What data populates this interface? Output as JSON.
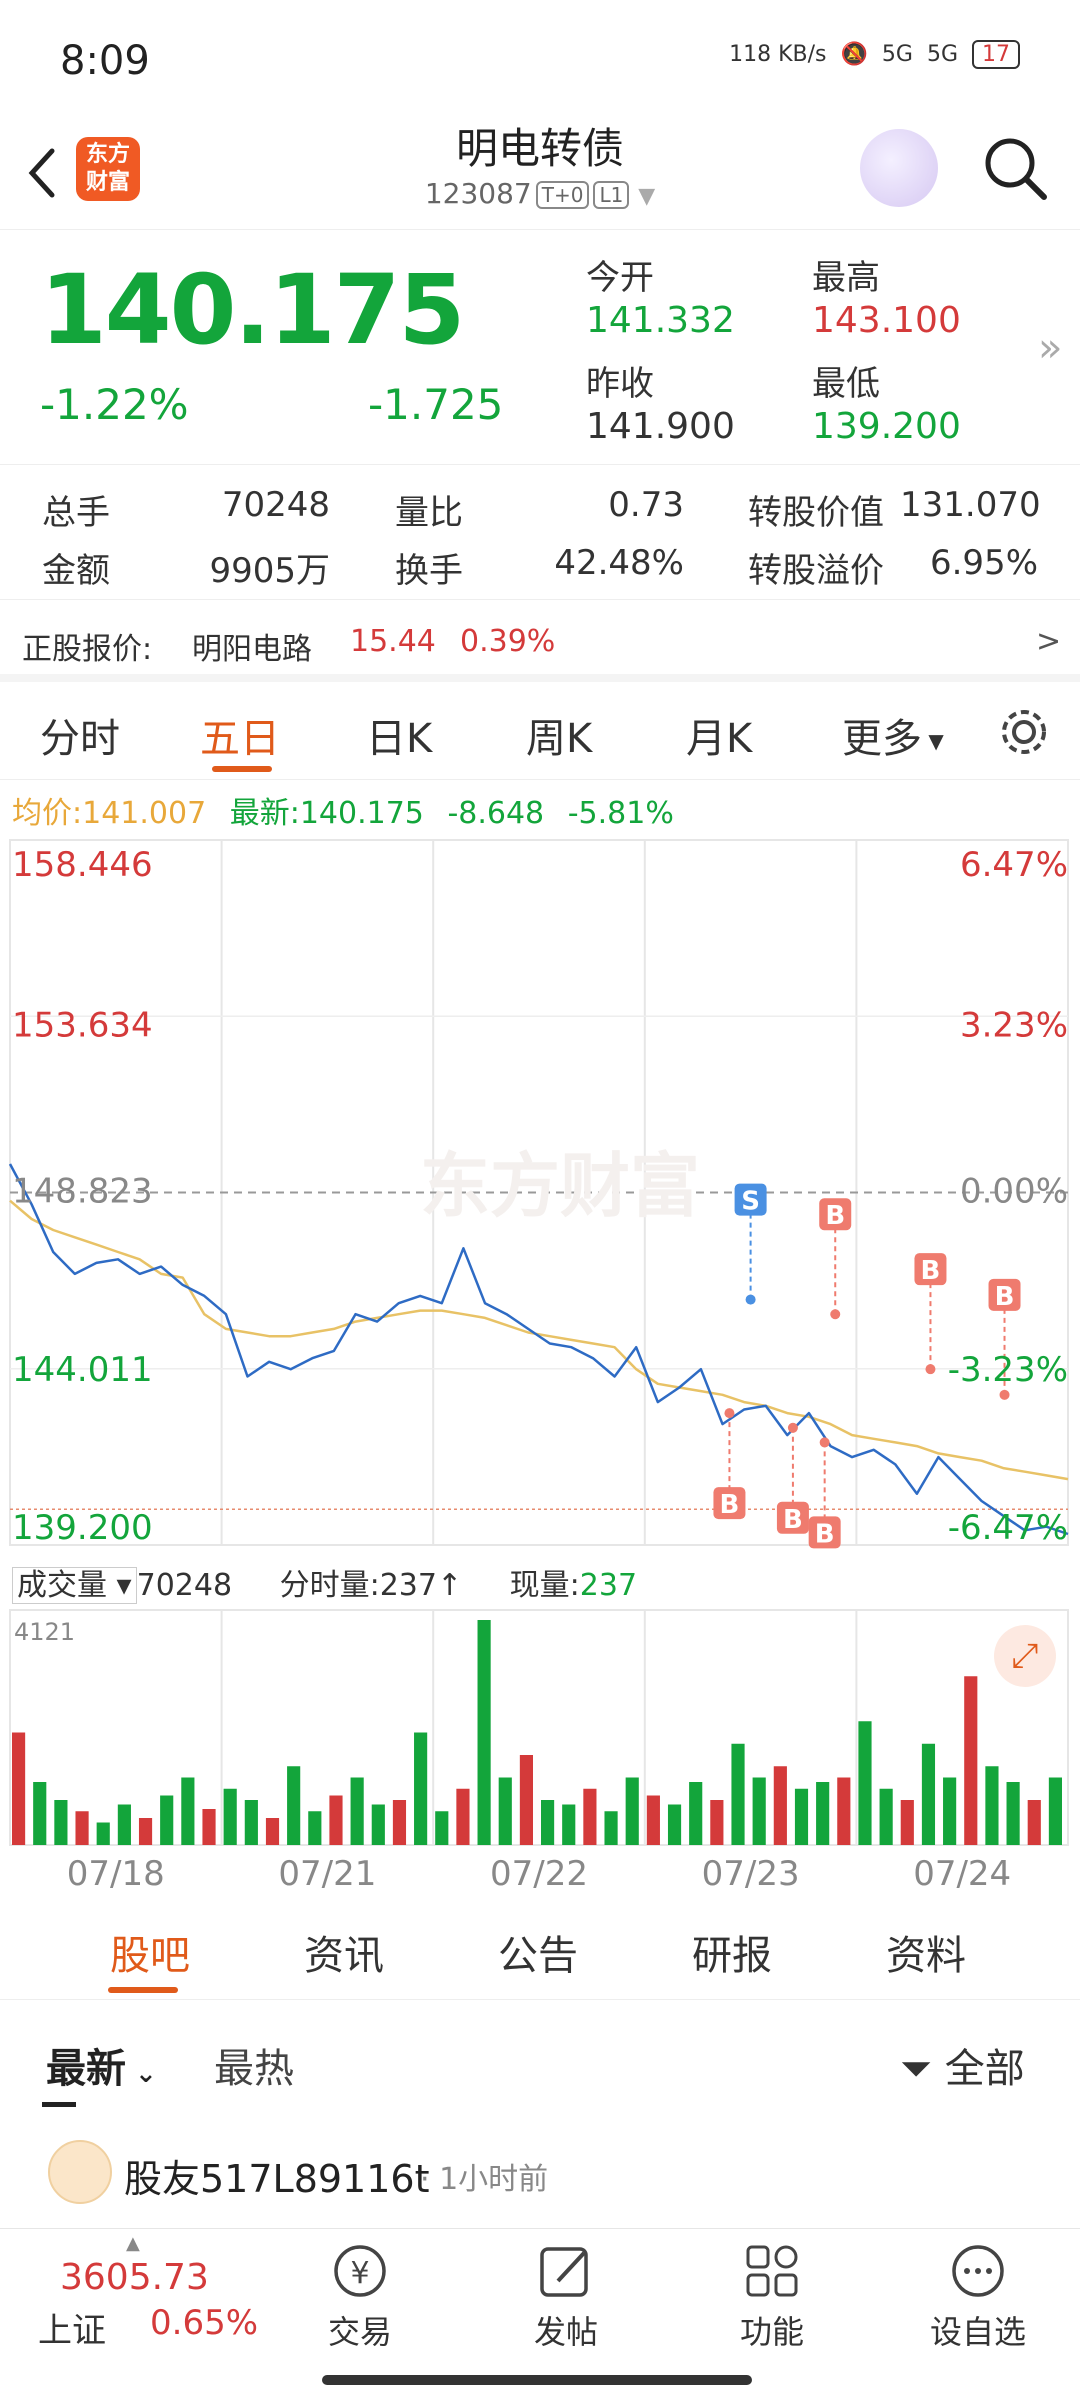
{
  "status": {
    "time": "8:09",
    "net_speed": "118 KB/s",
    "signal1": "5G",
    "signal2": "5G",
    "battery": "17"
  },
  "header": {
    "logo_text": "东方\n财富",
    "title": "明电转债",
    "code": "123087",
    "tag1": "T+0",
    "tag2": "L1"
  },
  "quote": {
    "price": "140.175",
    "pct": "-1.22%",
    "change": "-1.725",
    "open_label": "今开",
    "open": "141.332",
    "high_label": "最高",
    "high": "143.100",
    "prev_label": "昨收",
    "prev": "141.900",
    "low_label": "最低",
    "low": "139.200"
  },
  "stats": {
    "volume_label": "总手",
    "volume": "70248",
    "ratio_label": "量比",
    "ratio": "0.73",
    "conv_value_label": "转股价值",
    "conv_value": "131.070",
    "amount_label": "金额",
    "amount": "9905万",
    "turnover_label": "换手",
    "turnover": "42.48%",
    "premium_label": "转股溢价",
    "premium": "6.95%"
  },
  "stock": {
    "label": "正股报价:",
    "name": "明阳电路",
    "price": "15.44",
    "pct": "0.39%",
    "arrow": ">"
  },
  "tabs": [
    "分时",
    "五日",
    "日K",
    "周K",
    "月K",
    "更多"
  ],
  "chart_info": {
    "avg_label": "均价:",
    "avg": "141.007",
    "last_label": "最新:",
    "last": "140.175",
    "chg": "-8.648",
    "pct": "-5.81%"
  },
  "vol_info": {
    "vol_label": "成交量",
    "vol": "70248",
    "tick_label": "分时量:",
    "tick": "237",
    "now_label": "现量:",
    "now": "237"
  },
  "subtabs": [
    "股吧",
    "资讯",
    "公告",
    "研报",
    "资料"
  ],
  "feed": {
    "latest": "最新",
    "hot": "最热",
    "filter": "全部"
  },
  "post": {
    "user": "股友517L89116t",
    "time": "1小时前"
  },
  "bottom": {
    "index_value": "3605.73",
    "index_name": "上证",
    "index_pct": "0.65%",
    "nav": [
      "交易",
      "发帖",
      "功能",
      "设自选"
    ]
  },
  "chart_data": {
    "type": "line",
    "title": "",
    "x_labels": [
      "07/18",
      "07/21",
      "07/22",
      "07/23",
      "07/24"
    ],
    "y_left": [
      "158.446",
      "153.634",
      "148.823",
      "144.011",
      "139.200"
    ],
    "y_right": [
      "6.47%",
      "3.23%",
      "0.00%",
      "-3.23%",
      "-6.47%"
    ],
    "ylim": [
      139.2,
      158.446
    ],
    "prev_close": 148.823,
    "series": [
      {
        "values": [
          149.6,
          148.5,
          147.2,
          146.6,
          146.9,
          147.0,
          146.6,
          146.8,
          146.3,
          146.0,
          145.5,
          143.8,
          144.2,
          144.0,
          144.3,
          144.5,
          145.5,
          145.3,
          145.8,
          146.0,
          145.8,
          147.3,
          145.8,
          145.5,
          145.1,
          144.7,
          144.6,
          144.3,
          143.8,
          144.6,
          143.1,
          143.5,
          144.0,
          142.5,
          142.9,
          143.0,
          142.2,
          142.8,
          141.9,
          141.6,
          141.8,
          141.4,
          140.6,
          141.6,
          141.0,
          140.4,
          140.0,
          139.6,
          139.7,
          139.5
        ]
      },
      {
        "values": [
          148.6,
          148.1,
          147.8,
          147.6,
          147.4,
          147.2,
          147.0,
          146.6,
          146.5,
          145.5,
          145.1,
          145.0,
          144.9,
          144.9,
          145.0,
          145.1,
          145.3,
          145.4,
          145.5,
          145.6,
          145.6,
          145.5,
          145.4,
          145.2,
          145.0,
          144.9,
          144.8,
          144.7,
          144.6,
          144.0,
          143.6,
          143.5,
          143.4,
          143.3,
          143.1,
          143.0,
          142.8,
          142.7,
          142.5,
          142.2,
          142.1,
          142.0,
          141.9,
          141.7,
          141.6,
          141.5,
          141.3,
          141.2,
          141.1,
          141.0
        ]
      }
    ],
    "markers": [
      {
        "label": "S",
        "x": 0.7,
        "y": 145.9
      },
      {
        "label": "B",
        "x": 0.78,
        "y": 145.5
      },
      {
        "label": "B",
        "x": 0.87,
        "y": 144.0
      },
      {
        "label": "B",
        "x": 0.94,
        "y": 143.3
      },
      {
        "label": "B",
        "x": 0.68,
        "y": 142.8
      },
      {
        "label": "B",
        "x": 0.74,
        "y": 142.4
      },
      {
        "label": "B",
        "x": 0.77,
        "y": 142.0
      }
    ],
    "volume_max": "4121",
    "volume_bars": [
      0.5,
      0.28,
      0.2,
      0.15,
      0.1,
      0.18,
      0.12,
      0.22,
      0.3,
      0.16,
      0.25,
      0.2,
      0.12,
      0.35,
      0.15,
      0.22,
      0.3,
      0.18,
      0.2,
      0.5,
      0.15,
      0.25,
      1.0,
      0.3,
      0.4,
      0.2,
      0.18,
      0.25,
      0.15,
      0.3,
      0.22,
      0.18,
      0.28,
      0.2,
      0.45,
      0.3,
      0.35,
      0.25,
      0.28,
      0.3,
      0.55,
      0.25,
      0.2,
      0.45,
      0.3,
      0.75,
      0.35,
      0.28,
      0.2,
      0.3
    ]
  }
}
